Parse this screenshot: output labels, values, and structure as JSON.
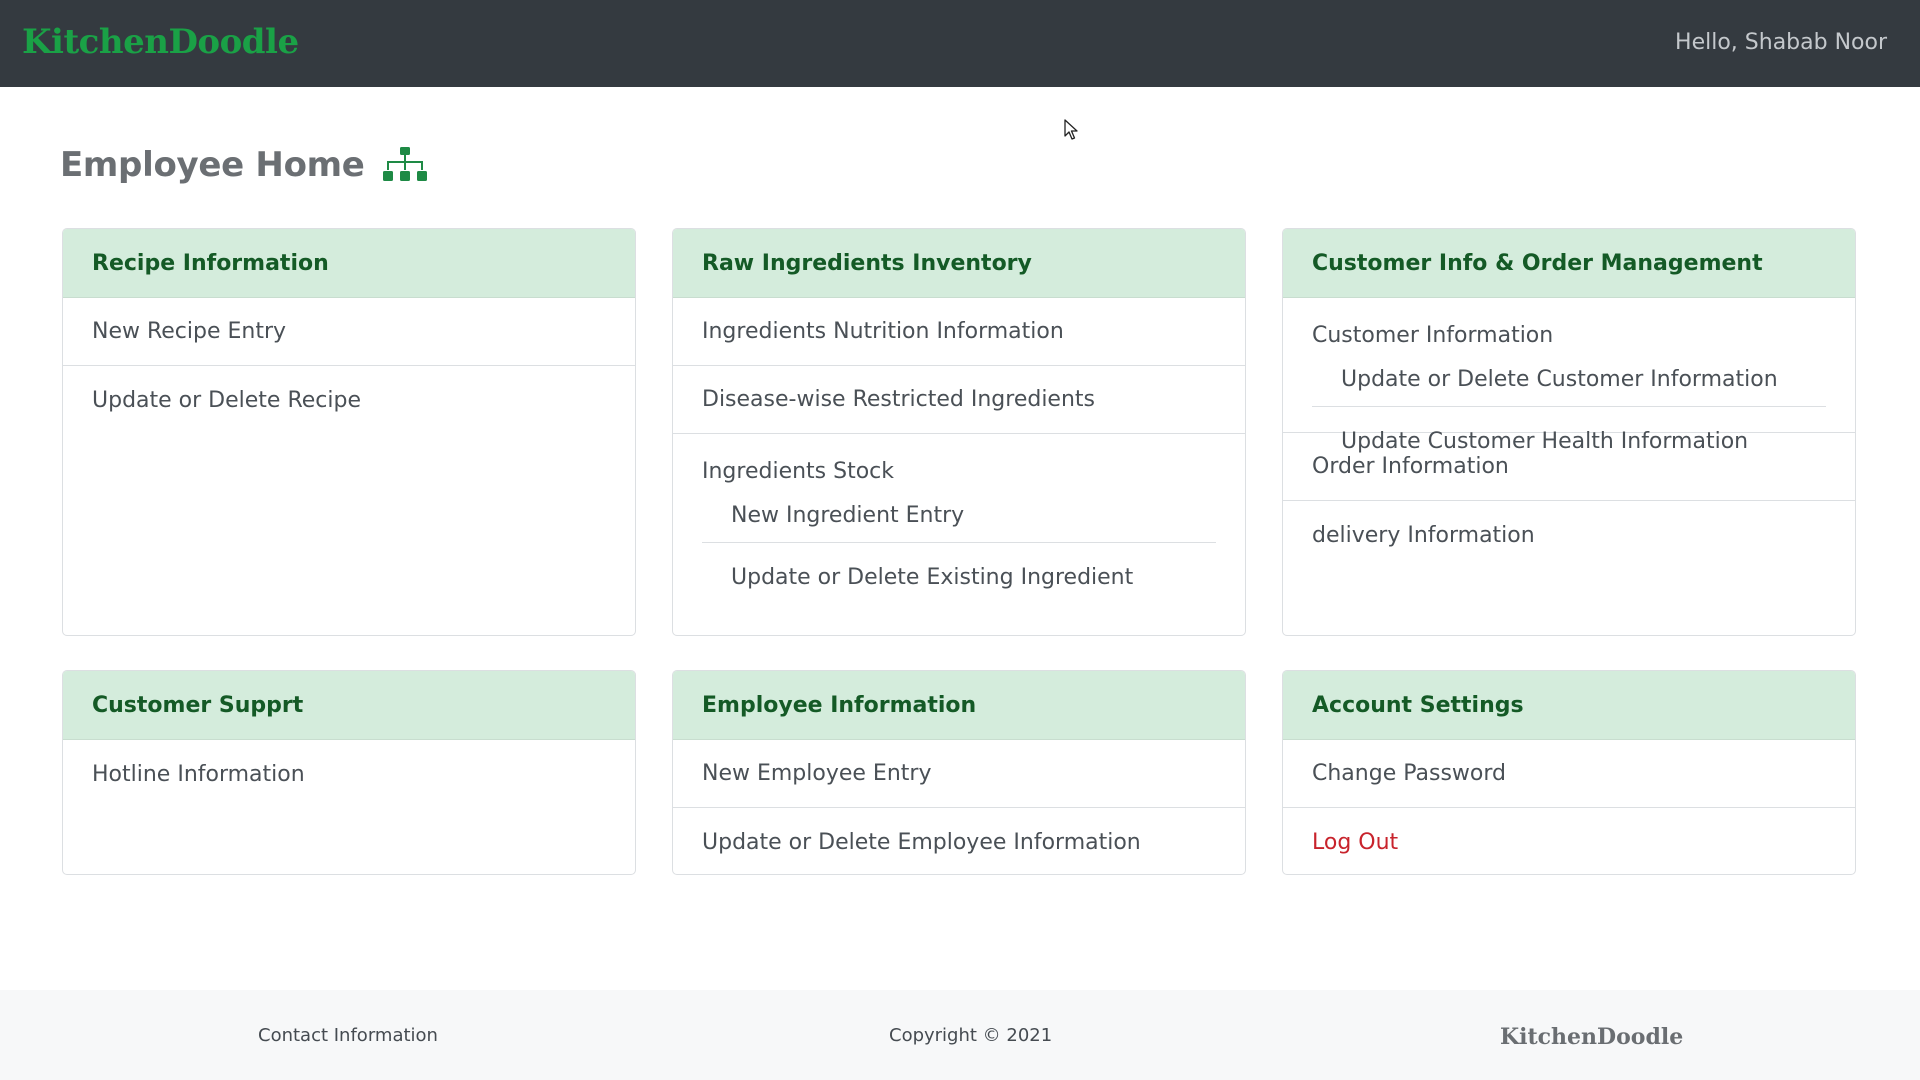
{
  "navbar": {
    "brand": "KitchenDoodle",
    "greeting": "Hello, Shabab Noor"
  },
  "page": {
    "title": "Employee Home",
    "title_icon": "sitemap-icon"
  },
  "cards": {
    "recipe": {
      "title": "Recipe Information",
      "items": [
        "New Recipe Entry",
        "Update or Delete Recipe"
      ]
    },
    "ingredients": {
      "title": "Raw Ingredients Inventory",
      "items": [
        "Ingredients Nutrition Information",
        "Disease-wise Restricted Ingredients"
      ],
      "stock": {
        "title": "Ingredients Stock",
        "items": [
          "New Ingredient Entry",
          "Update or Delete Existing Ingredient"
        ]
      }
    },
    "customer": {
      "title": "Customer Info & Order Management",
      "info": {
        "title": "Customer Information",
        "items": [
          "Update or Delete Customer Information",
          "Update Customer Health Information"
        ]
      },
      "items": [
        "Order Information",
        "delivery Information"
      ]
    },
    "support": {
      "title": "Customer Supprt",
      "items": [
        "Hotline Information"
      ]
    },
    "employee": {
      "title": "Employee Information",
      "items": [
        "New Employee Entry",
        "Update or Delete Employee Information"
      ]
    },
    "account": {
      "title": "Account Settings",
      "items": [
        "Change Password",
        "Log Out"
      ]
    }
  },
  "footer": {
    "contact": "Contact Information",
    "copyright": "Copyright © 2021",
    "brand": "KitchenDoodle"
  },
  "colors": {
    "navbar_bg": "#343a40",
    "brand_green": "#1aa146",
    "card_header_bg": "#d4ecdc",
    "card_header_text": "#145a26",
    "logout_red": "#c8232c"
  }
}
